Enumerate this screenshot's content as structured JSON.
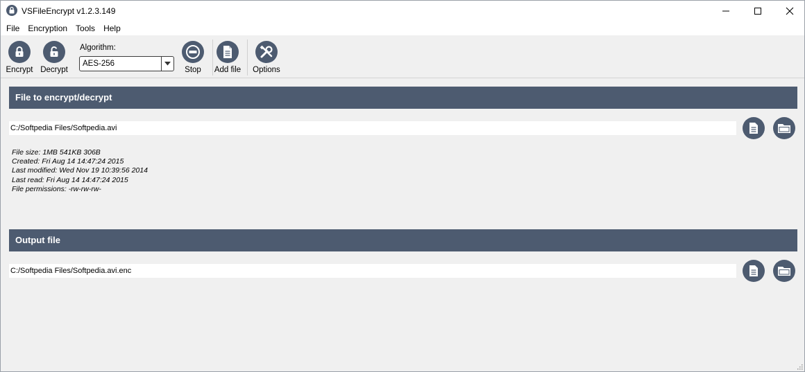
{
  "window": {
    "title": "VSFileEncrypt v1.2.3.149"
  },
  "menu": {
    "items": [
      "File",
      "Encryption",
      "Tools",
      "Help"
    ]
  },
  "toolbar": {
    "encrypt_label": "Encrypt",
    "decrypt_label": "Decrypt",
    "algorithm_label": "Algorithm:",
    "algorithm_value": "AES-256",
    "stop_label": "Stop",
    "add_file_label": "Add file",
    "options_label": "Options"
  },
  "input_section": {
    "title": "File to encrypt/decrypt",
    "path": "C:/Softpedia Files/Softpedia.avi",
    "info": {
      "size": "File size: 1MB 541KB 306B",
      "created": "Created: Fri Aug 14 14:47:24 2015",
      "modified": "Last modified: Wed Nov 19 10:39:56 2014",
      "read": "Last read: Fri Aug 14 14:47:24 2015",
      "permissions": "File permissions: -rw-rw-rw-"
    }
  },
  "output_section": {
    "title": "Output file",
    "path": "C:/Softpedia Files/Softpedia.avi.enc"
  },
  "colors": {
    "accent": "#4d5b70",
    "titlebar": "#ffffff",
    "background": "#f0f0f0"
  },
  "icons": {
    "encrypt": "lock-closed-icon",
    "decrypt": "lock-open-icon",
    "stop": "stop-icon",
    "add_file": "document-icon",
    "options": "tools-icon",
    "browse_file": "document-icon",
    "browse_folder": "folder-icon"
  }
}
